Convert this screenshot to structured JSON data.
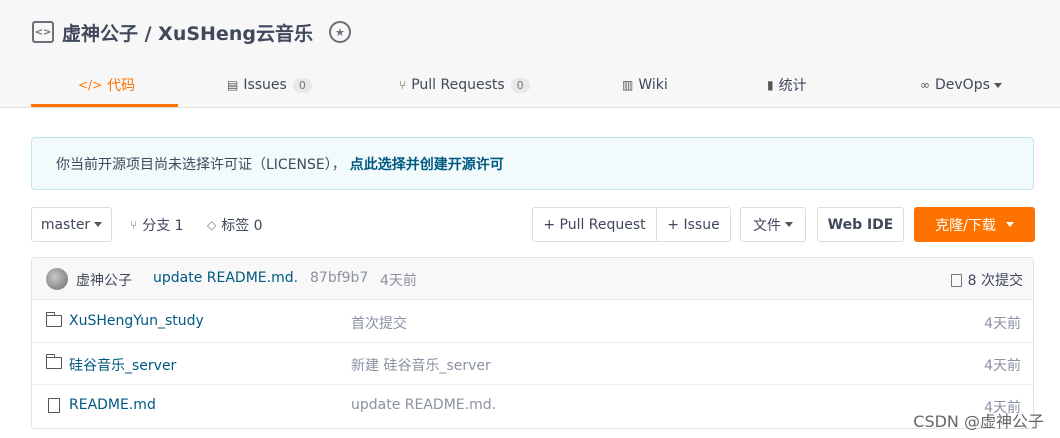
{
  "repo": {
    "title": "虚神公子 / XuSHeng云音乐",
    "icon": "code-bracket-icon",
    "badge_icon": "award-badge-icon"
  },
  "tabs": [
    {
      "label": "代码",
      "icon": "</>",
      "active": true
    },
    {
      "label": "Issues",
      "icon": "▤",
      "count": "0"
    },
    {
      "label": "Pull Requests",
      "icon": "⑂",
      "count": "0"
    },
    {
      "label": "Wiki",
      "icon": "▥"
    },
    {
      "label": "统计",
      "icon": "▮"
    },
    {
      "label": "DevOps",
      "icon": "∞"
    }
  ],
  "notice": {
    "text": "你当前开源项目尚未选择许可证（LICENSE），",
    "link": "点此选择并创建开源许可"
  },
  "toolbar": {
    "branch": "master",
    "branches_label": "分支 1",
    "tags_label": "标签 0",
    "pull_request": "+ Pull Request",
    "issue": "+ Issue",
    "files": "文件",
    "web_ide": "Web IDE",
    "clone": "克隆/下载"
  },
  "commit": {
    "author": "虚神公子",
    "message": "update README.md.",
    "hash": "87bf9b7",
    "time": "4天前",
    "count": "8 次提交"
  },
  "files": [
    {
      "name": "XuSHengYun_study",
      "type": "folder",
      "message": "首次提交",
      "time": "4天前"
    },
    {
      "name": "硅谷音乐_server",
      "type": "folder",
      "message": "新建 硅谷音乐_server",
      "time": "4天前"
    },
    {
      "name": "README.md",
      "type": "file",
      "message": "update README.md.",
      "time": "4天前"
    }
  ],
  "watermark": "CSDN @虚神公子",
  "colors": {
    "accent": "#fe7300",
    "link": "#005980"
  }
}
